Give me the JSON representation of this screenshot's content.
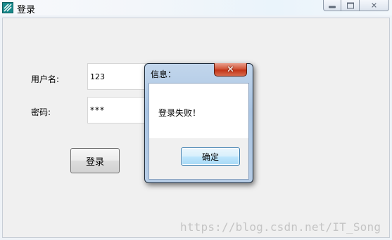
{
  "window": {
    "title": "登录",
    "icon": "app-icon"
  },
  "form": {
    "username_label": "用户名:",
    "username_value": "123",
    "password_label": "密码:",
    "password_value": "***",
    "login_button": "登录"
  },
  "dialog": {
    "title": "信息：",
    "message": "登录失败！",
    "ok_button": "确定",
    "close_icon": "close-icon"
  },
  "watermark": "https://blog.csdn.net/IT_Song",
  "colors": {
    "client_bg": "#f0f0f0",
    "dialog_frame": "#b7cde6",
    "close_button": "#c23418",
    "ok_button_border": "#3c7fb1"
  }
}
